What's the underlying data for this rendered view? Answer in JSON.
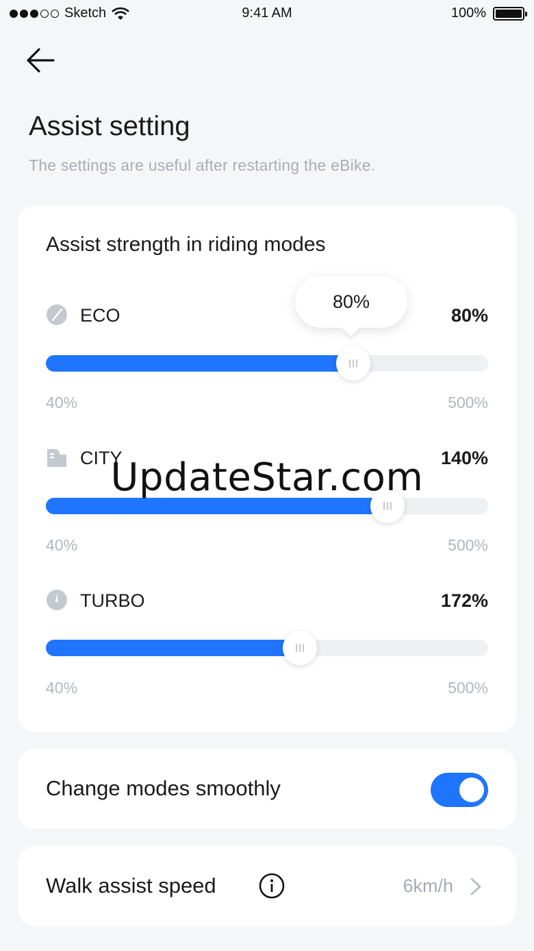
{
  "status_bar": {
    "carrier": "Sketch",
    "time": "9:41 AM",
    "battery": "100%"
  },
  "header": {
    "back_icon": "arrow-left-icon",
    "title": "Assist setting",
    "subtitle": "The settings are useful after restarting the eBike."
  },
  "assist_strength": {
    "title": "Assist strength in riding modes",
    "range_min": "40%",
    "range_max": "500%",
    "modes": [
      {
        "name": "ECO",
        "value": "80%",
        "icon": "leaf-icon",
        "slider_fraction": 0.695,
        "tooltip": "80%"
      },
      {
        "name": "CITY",
        "value": "140%",
        "icon": "building-icon",
        "slider_fraction": 0.773
      },
      {
        "name": "TURBO",
        "value": "172%",
        "icon": "speedometer-icon",
        "slider_fraction": 0.574
      }
    ]
  },
  "smooth_mode": {
    "label": "Change modes smoothly",
    "enabled": true
  },
  "walk_assist": {
    "label": "Walk assist speed",
    "info_icon": "info-icon",
    "value": "6km/h",
    "chevron_icon": "chevron-right-icon"
  },
  "watermark": "UpdateStar.com",
  "colors": {
    "accent": "#1f75fe",
    "track": "#eef0f3",
    "muted_text": "#a8aeb6",
    "background": "#f5f6f8"
  }
}
